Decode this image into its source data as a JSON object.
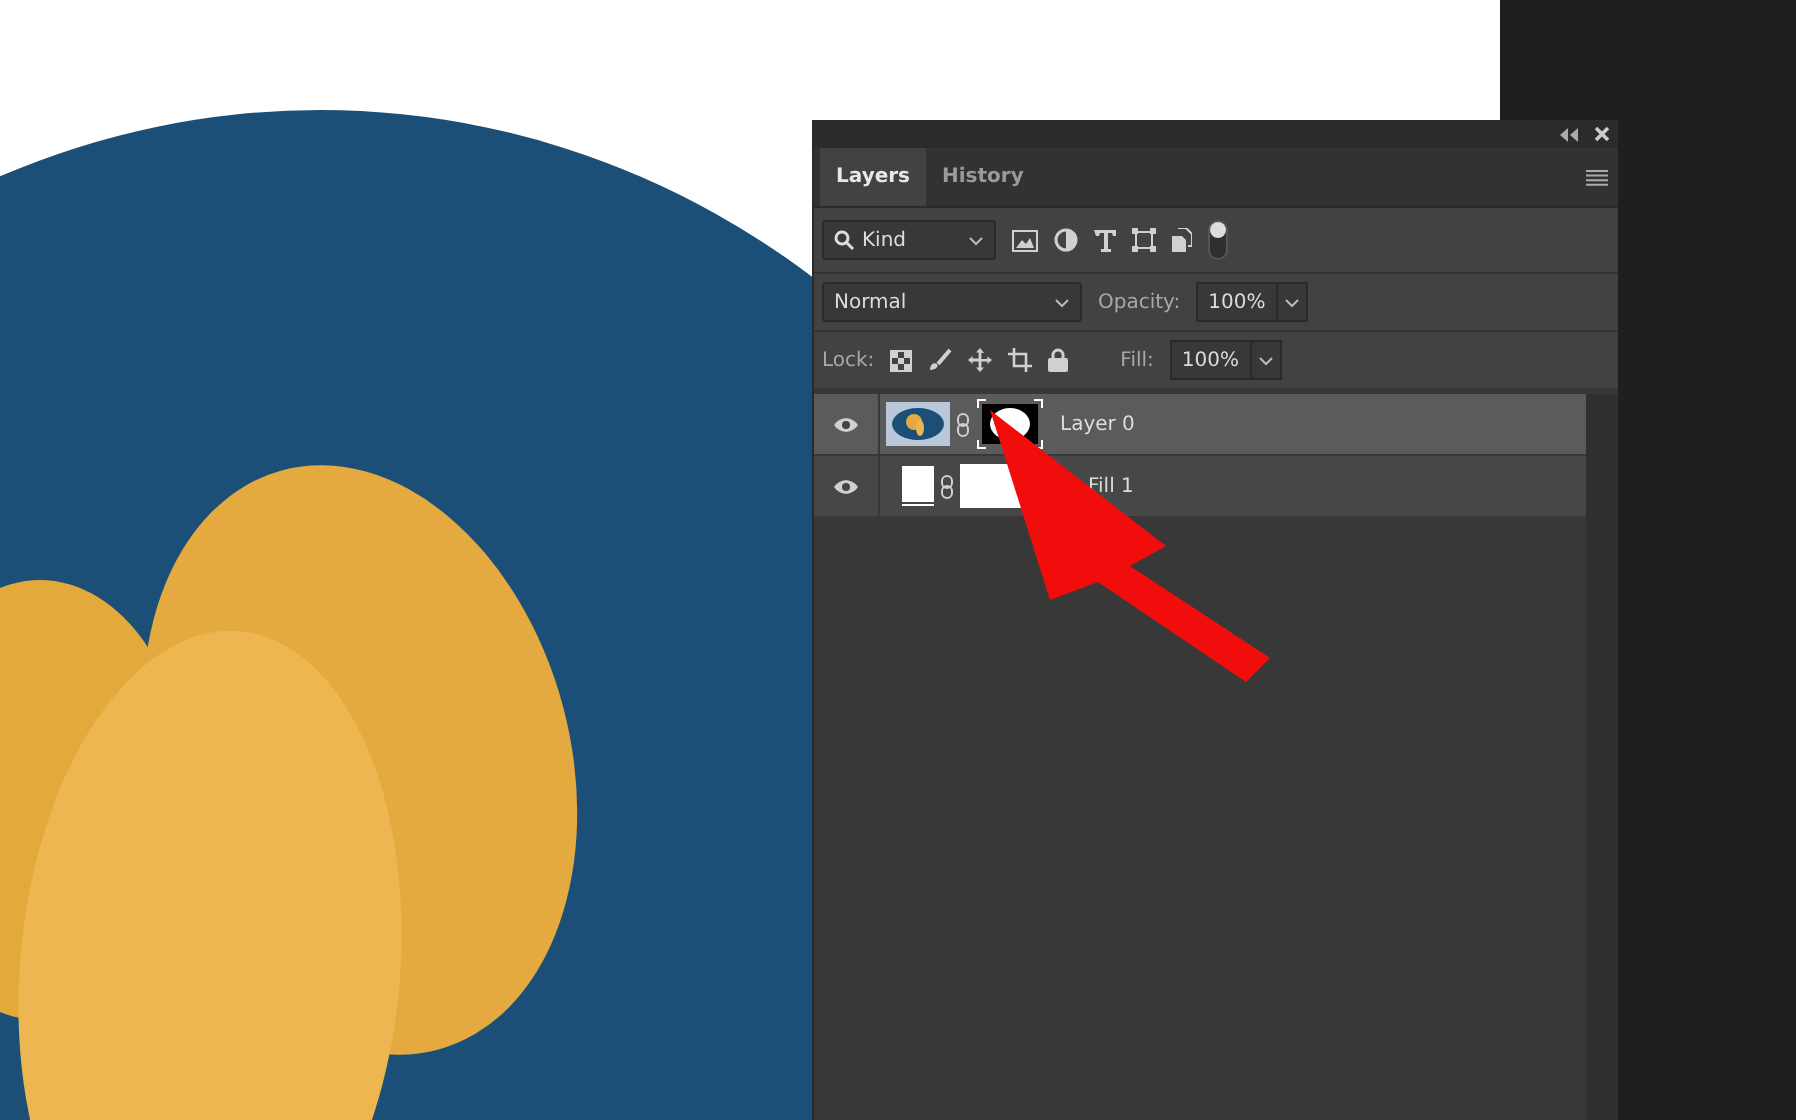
{
  "panel": {
    "tabs": [
      {
        "label": "Layers",
        "selected": true
      },
      {
        "label": "History",
        "selected": false
      }
    ],
    "filter": {
      "value": "Kind"
    },
    "blend_mode": {
      "value": "Normal"
    },
    "opacity": {
      "label": "Opacity:",
      "value": "100%"
    },
    "lock": {
      "label": "Lock:"
    },
    "fill": {
      "label": "Fill:",
      "value": "100%"
    },
    "layers": [
      {
        "name": "Layer 0",
        "kind": "masked",
        "selected": true,
        "visible": true
      },
      {
        "name": "Fill 1",
        "kind": "fill",
        "selected": false,
        "visible": true
      }
    ]
  }
}
